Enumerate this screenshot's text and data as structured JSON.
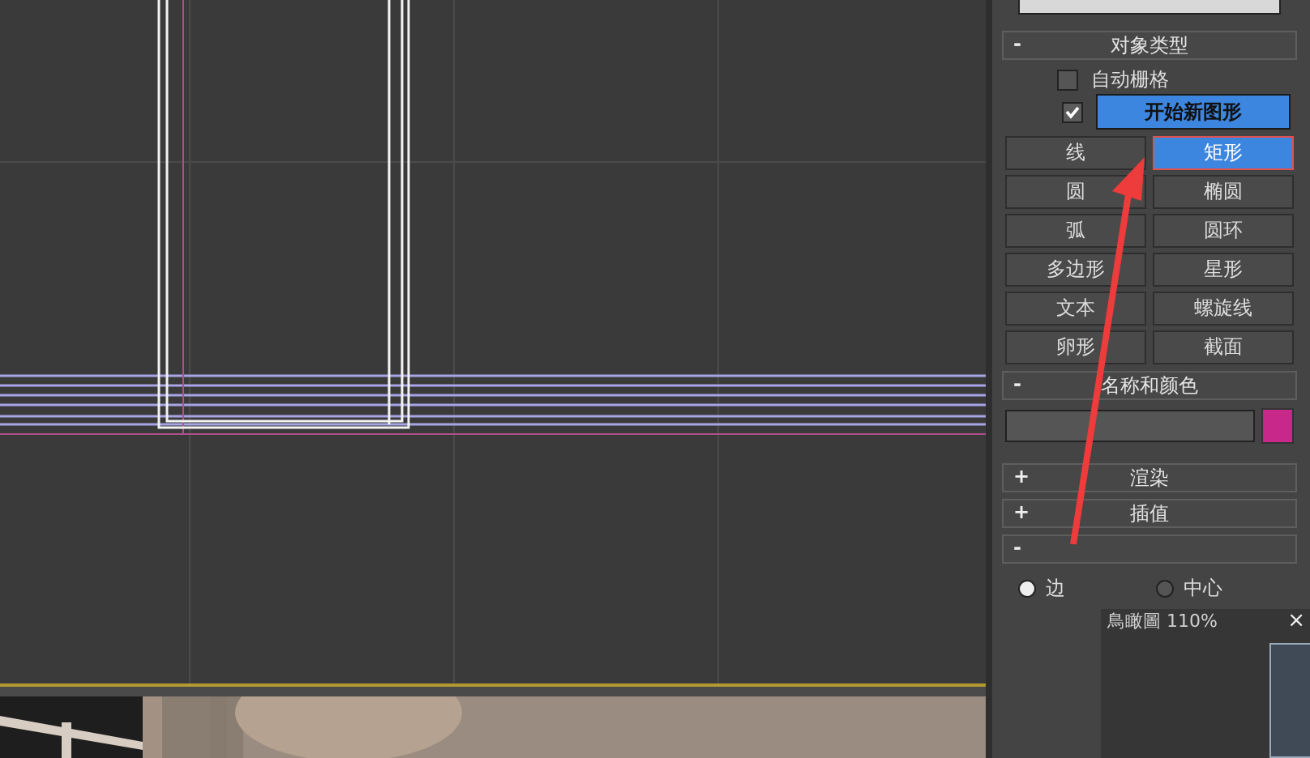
{
  "viewport": {
    "kind": "shapes"
  },
  "command_panel": {
    "rollouts": [
      {
        "kind": "object_type",
        "sign": "-",
        "title": "对象类型",
        "auto_grid": {
          "label": "自动栅格",
          "checked": false
        },
        "start_new": {
          "label": "开始新图形",
          "checked": true
        },
        "buttons": [
          {
            "label": "线",
            "selected": false
          },
          {
            "label": "矩形",
            "selected": true
          },
          {
            "label": "圆",
            "selected": false
          },
          {
            "label": "椭圆",
            "selected": false
          },
          {
            "label": "弧",
            "selected": false
          },
          {
            "label": "圆环",
            "selected": false
          },
          {
            "label": "多边形",
            "selected": false
          },
          {
            "label": "星形",
            "selected": false
          },
          {
            "label": "文本",
            "selected": false
          },
          {
            "label": "螺旋线",
            "selected": false
          },
          {
            "label": "卵形",
            "selected": false
          },
          {
            "label": "截面",
            "selected": false
          }
        ]
      },
      {
        "kind": "name_color",
        "sign": "-",
        "title": "名称和颜色",
        "color": "#c8288a"
      },
      {
        "kind": "collapsed",
        "sign": "+",
        "title": "渲染"
      },
      {
        "kind": "collapsed",
        "sign": "+",
        "title": "插值"
      },
      {
        "kind": "creation_method",
        "sign": "-",
        "radios": [
          {
            "label": "边",
            "selected": true
          },
          {
            "label": "中心",
            "selected": false
          }
        ]
      }
    ]
  },
  "overview_popup": {
    "title": "鳥瞰圖 110%",
    "close": "×"
  }
}
